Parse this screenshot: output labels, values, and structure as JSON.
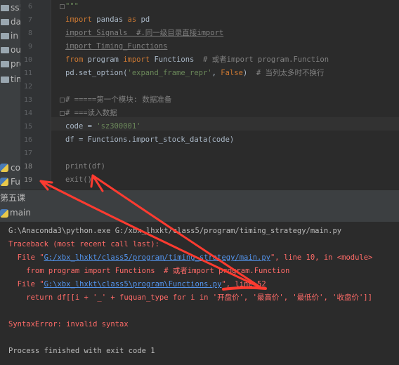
{
  "tree": {
    "items": [
      {
        "label": "ss5 [c",
        "icon": "folder-icon"
      },
      {
        "label": "data",
        "icon": "folder-icon"
      },
      {
        "label": "in",
        "icon": "folder-icon"
      },
      {
        "label": "ou",
        "icon": "folder-icon"
      },
      {
        "label": "prog",
        "icon": "folder-icon"
      },
      {
        "label": "tin",
        "icon": "folder-icon"
      },
      {
        "label": "co",
        "icon": "python-file-icon"
      },
      {
        "label": "Fu",
        "icon": "python-file-icon"
      }
    ]
  },
  "editor": {
    "line_numbers": [
      "6",
      "7",
      "8",
      "9",
      "10",
      "11",
      "12",
      "13",
      "14",
      "15",
      "16",
      "17",
      "18",
      "19"
    ],
    "lines": [
      {
        "segments": [
          {
            "t": "\"\"\"",
            "c": "str"
          }
        ]
      },
      {
        "segments": [
          {
            "t": "import",
            "c": "kw"
          },
          {
            "t": " pandas ",
            "c": ""
          },
          {
            "t": "as",
            "c": "kw"
          },
          {
            "t": " pd",
            "c": ""
          }
        ]
      },
      {
        "segments": [
          {
            "t": "import Signals  #.同一级目录直接import",
            "c": "cmt ul"
          }
        ]
      },
      {
        "segments": [
          {
            "t": "import Timing_Functions",
            "c": "cmt ul"
          }
        ]
      },
      {
        "segments": [
          {
            "t": "from",
            "c": "kw"
          },
          {
            "t": " program ",
            "c": ""
          },
          {
            "t": "import",
            "c": "kw"
          },
          {
            "t": " Functions  ",
            "c": ""
          },
          {
            "t": "# 或者import program.Function",
            "c": "cmt"
          }
        ]
      },
      {
        "segments": [
          {
            "t": "pd.set_option(",
            "c": ""
          },
          {
            "t": "'expand_frame_repr'",
            "c": "str"
          },
          {
            "t": ", ",
            "c": ""
          },
          {
            "t": "False",
            "c": "kw"
          },
          {
            "t": ")  ",
            "c": ""
          },
          {
            "t": "# 当列太多时不换行",
            "c": "cmt"
          }
        ]
      },
      {
        "segments": []
      },
      {
        "segments": [
          {
            "t": "# =====第一个模块: 数据准备",
            "c": "cmt"
          }
        ]
      },
      {
        "segments": [
          {
            "t": "# ===读入数据",
            "c": "cmt"
          }
        ]
      },
      {
        "segments": [
          {
            "t": "code = ",
            "c": ""
          },
          {
            "t": "'sz300001'",
            "c": "str"
          }
        ]
      },
      {
        "segments": [
          {
            "t": "df = Functions.import_stock_data(code)",
            "c": ""
          }
        ]
      },
      {
        "segments": []
      },
      {
        "segments": [
          {
            "t": "print(df)",
            "c": "cmt"
          }
        ]
      },
      {
        "segments": [
          {
            "t": "exit()",
            "c": "cmt"
          }
        ]
      }
    ]
  },
  "run_tab": {
    "label": "第五课"
  },
  "run_config": {
    "label": "main"
  },
  "console": {
    "lines": [
      {
        "segments": [
          {
            "t": "G:\\Anaconda3\\python.exe G:/xbx_lhxkt/class5/program/timing_strategy/main.py",
            "c": "wht"
          }
        ]
      },
      {
        "segments": [
          {
            "t": "Traceback (most recent call last):",
            "c": "red"
          }
        ]
      },
      {
        "segments": [
          {
            "t": "  File \"",
            "c": "red"
          },
          {
            "t": "G:/xbx_lhxkt/class5/program/timing_strategy/main.py",
            "c": "link"
          },
          {
            "t": "\", line 10, in <module>",
            "c": "red"
          }
        ]
      },
      {
        "segments": [
          {
            "t": "    from program import Functions  # 或者import program.Function",
            "c": "red"
          }
        ]
      },
      {
        "segments": [
          {
            "t": "  File \"",
            "c": "red"
          },
          {
            "t": "G:\\xbx_lhxkt\\class5\\program\\Functions.py",
            "c": "link"
          },
          {
            "t": "\", line 52",
            "c": "red"
          }
        ]
      },
      {
        "segments": [
          {
            "t": "    return df[[i + '_' + fuquan_type for i in '开盘价', '最高价', '最低价', '收盘价']]",
            "c": "red"
          }
        ]
      },
      {
        "segments": []
      },
      {
        "segments": [
          {
            "t": "SyntaxError: invalid syntax",
            "c": "red"
          }
        ]
      },
      {
        "segments": []
      },
      {
        "segments": [
          {
            "t": "Process finished with exit code 1",
            "c": "wht"
          }
        ]
      }
    ]
  },
  "colors": {
    "annotation": "#ff3b30",
    "keyword": "#cc7832",
    "string": "#6a8759",
    "comment": "#808080",
    "error": "#ff6b68",
    "link": "#5394ec"
  }
}
